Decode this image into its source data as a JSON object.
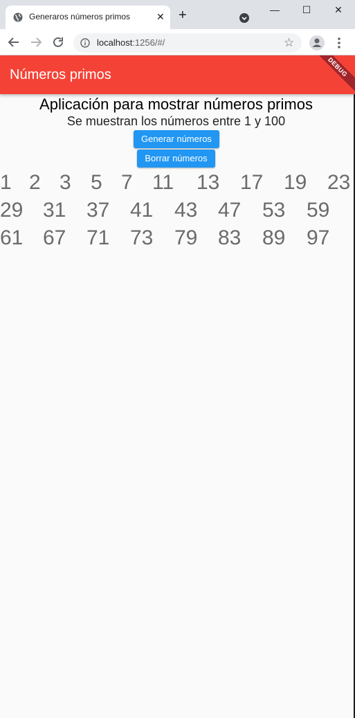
{
  "browser": {
    "tab_title": "Generaros números primos",
    "tab_close": "✕",
    "new_tab": "+",
    "window_minimize": "—",
    "window_maximize": "☐",
    "window_close": "✕",
    "url_host": "localhost",
    "url_rest": ":1256/#/",
    "bookmark_icon": "☆"
  },
  "app": {
    "title": "Números primos",
    "debug_label": "DEBUG",
    "accent_color": "#f44336",
    "button_color": "#2196f3"
  },
  "main": {
    "headline": "Aplicación para mostrar números primos",
    "subhead": "Se muestran los números entre 1 y 100",
    "generate_label": "Generar números",
    "clear_label": "Borrar números"
  },
  "primes": [
    "1",
    "2",
    "3",
    "5",
    "7",
    "11",
    "13",
    "17",
    "19",
    "23",
    "29",
    "31",
    "37",
    "41",
    "43",
    "47",
    "53",
    "59",
    "61",
    "67",
    "71",
    "73",
    "79",
    "83",
    "89",
    "97"
  ]
}
